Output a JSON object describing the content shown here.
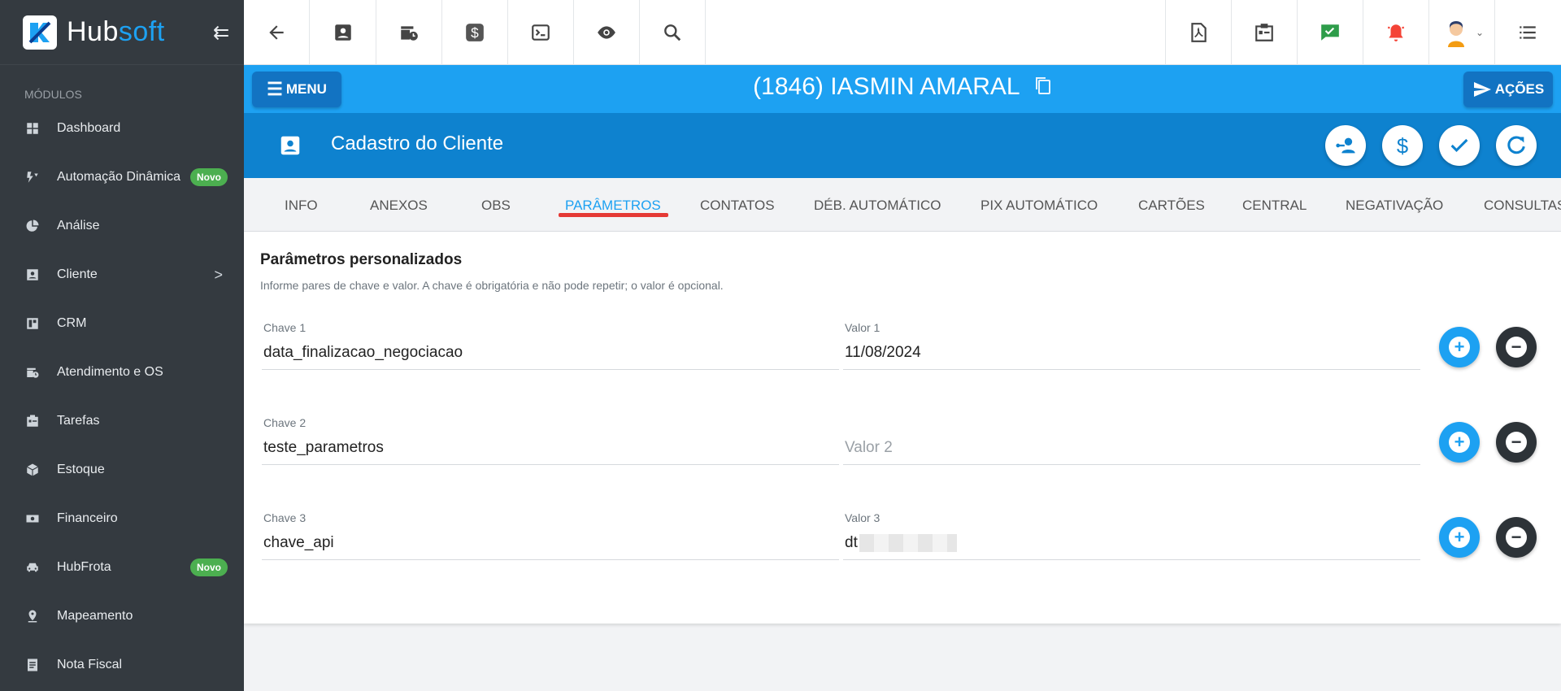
{
  "brand": {
    "name_part1": "Hub",
    "name_part2": "soft"
  },
  "sidebar": {
    "section_label": "MÓDULOS",
    "items": [
      {
        "label": "Dashboard",
        "icon": "dashboard-icon"
      },
      {
        "label": "Automação Dinâmica",
        "icon": "automation-icon",
        "badge": "Novo"
      },
      {
        "label": "Análise",
        "icon": "pie-chart-icon"
      },
      {
        "label": "Cliente",
        "icon": "contact-card-icon",
        "chevron": ">"
      },
      {
        "label": "CRM",
        "icon": "board-icon"
      },
      {
        "label": "Atendimento e OS",
        "icon": "calendar-clock-icon"
      },
      {
        "label": "Tarefas",
        "icon": "tasks-icon"
      },
      {
        "label": "Estoque",
        "icon": "box-icon"
      },
      {
        "label": "Financeiro",
        "icon": "money-icon"
      },
      {
        "label": "HubFrota",
        "icon": "car-icon",
        "badge": "Novo"
      },
      {
        "label": "Mapeamento",
        "icon": "map-pin-icon"
      },
      {
        "label": "Nota Fiscal",
        "icon": "invoice-icon"
      }
    ]
  },
  "client_bar": {
    "menu_label": "MENU",
    "title": "(1846) IASMIN AMARAL",
    "actions_label": "AÇÕES"
  },
  "section": {
    "title": "Cadastro do Cliente"
  },
  "tabs": [
    {
      "label": "INFO"
    },
    {
      "label": "ANEXOS"
    },
    {
      "label": "OBS"
    },
    {
      "label": "PARÂMETROS",
      "active": true
    },
    {
      "label": "CONTATOS"
    },
    {
      "label": "DÉB. AUTOMÁTICO"
    },
    {
      "label": "PIX AUTOMÁTICO"
    },
    {
      "label": "CARTÕES"
    },
    {
      "label": "CENTRAL"
    },
    {
      "label": "NEGATIVAÇÃO"
    },
    {
      "label": "CONSULTAS"
    }
  ],
  "params": {
    "title": "Parâmetros personalizados",
    "subtitle": "Informe pares de chave e valor. A chave é obrigatória e não pode repetir; o valor é opcional.",
    "rows": [
      {
        "key_label": "Chave 1",
        "key_value": "data_finalizacao_negociacao",
        "value_label": "Valor 1",
        "value_value": "11/08/2024"
      },
      {
        "key_label": "Chave 2",
        "key_value": "teste_parametros",
        "value_label": "",
        "value_placeholder": "Valor 2"
      },
      {
        "key_label": "Chave 3",
        "key_value": "chave_api",
        "value_label": "Valor 3",
        "value_value": "dt"
      }
    ]
  },
  "colors": {
    "sidebar_bg": "#343a40",
    "client_bar": "#1da1f2",
    "section_bar": "#0e82cf",
    "active_tab": "#1da1f2",
    "tab_underline": "#e53935"
  }
}
